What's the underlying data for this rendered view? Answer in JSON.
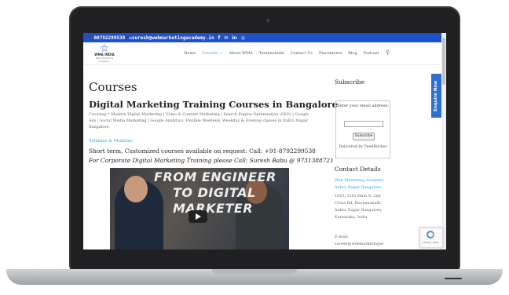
{
  "topbar": {
    "phone": "📞08792299538",
    "email": "✉suresh@webmarketingacademy.in",
    "social": [
      "f",
      "✉",
      "in",
      "◎"
    ]
  },
  "logo": {
    "mark": "⚝",
    "name": "WMA INDIA",
    "tagline": "Web Marketing Academy"
  },
  "nav": {
    "items": [
      "Home",
      "Courses ⌄",
      "About WMA",
      "Testimonials",
      "Contact Us",
      "Placements",
      "Blog",
      "Podcast"
    ],
    "search_icon": "⚲"
  },
  "main": {
    "title": "Courses",
    "subtitle": "Digital Marketing Training Courses in Bangalore",
    "covering": "Covering * Modern Digital Marketing | Video & Content Marketing | Search Engine Optimization (SEO) | Google Ads | Social Media Marketing | Google Analytics. Flexible Weekend, Weekday & Evening classes in Indira Nagar, Bangalore.",
    "syllabus_link": "Syllabus & Modules",
    "short_term": "Short term, Customized courses available on request: Call: +91-8792299538",
    "corporate": "For Corporate Digital Marketing Training please Call: Suresh Babu @ 9731388721",
    "video": {
      "line1": "FROM ENGINEER",
      "line2": "TO DIGITAL",
      "line3": "MARKETER"
    }
  },
  "sidebar": {
    "subscribe_heading": "Subscribe",
    "enter_email": "Enter your email address:",
    "subscribe_button": "Subscribe",
    "delivered_by": "Delivered by FeedBurner",
    "contact_heading": "Contact Details",
    "contact_link": "Web Marketing Academy Indira Nagar Bangalore",
    "address": "1003, 12th Main A, 2nd Cross Rd, Doopanahalli, Indira Nagar Bangalore, Karnataka, India",
    "email_label": "E-mail:",
    "email": "suresh@webmarketingac"
  },
  "enquire": "Enquire Now",
  "recaptcha": "Privacy - Terms"
}
